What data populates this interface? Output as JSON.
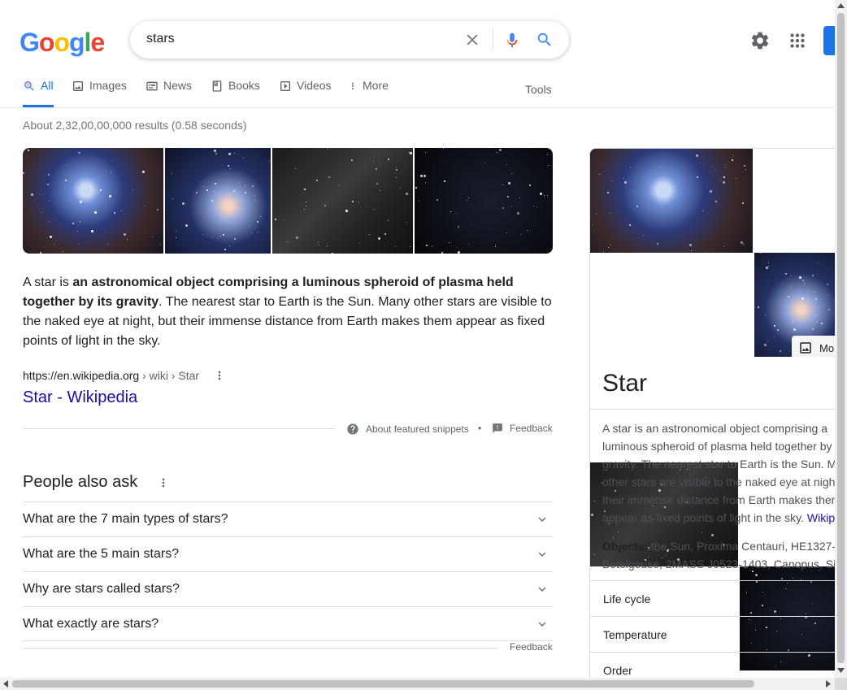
{
  "header": {
    "logo_letters": [
      {
        "ch": "G",
        "color": "#4285F4"
      },
      {
        "ch": "o",
        "color": "#EA4335"
      },
      {
        "ch": "o",
        "color": "#FBBC05"
      },
      {
        "ch": "g",
        "color": "#4285F4"
      },
      {
        "ch": "l",
        "color": "#34A853"
      },
      {
        "ch": "e",
        "color": "#EA4335"
      }
    ],
    "search_query": "stars"
  },
  "tabs": [
    {
      "label": "All",
      "icon": "search-icon",
      "active": true
    },
    {
      "label": "Images",
      "icon": "image-icon",
      "active": false
    },
    {
      "label": "News",
      "icon": "news-icon",
      "active": false
    },
    {
      "label": "Books",
      "icon": "book-icon",
      "active": false
    },
    {
      "label": "Videos",
      "icon": "video-icon",
      "active": false
    },
    {
      "label": "More",
      "icon": "more-vert-icon",
      "active": false
    }
  ],
  "tools_label": "Tools",
  "result_stats": "About 2,32,00,00,000 results (0.58 seconds)",
  "featured_snippet": {
    "prefix": "A star is ",
    "bold": "an astronomical object comprising a luminous spheroid of plasma held together by its gravity",
    "suffix": ". The nearest star to Earth is the Sun. Many other stars are visible to the naked eye at night, but their immense distance from Earth makes them appear as fixed points of light in the sky.",
    "cite_domain": "https://en.wikipedia.org",
    "cite_path": " › wiki › Star",
    "link_title": "Star - Wikipedia",
    "about_label": "About featured snippets",
    "separator": "•",
    "feedback_label": "Feedback"
  },
  "people_also_ask": {
    "title": "People also ask",
    "questions": [
      "What are the 7 main types of stars?",
      "What are the 5 main stars?",
      "Why are stars called stars?",
      "What exactly are stars?"
    ],
    "feedback_label": "Feedback"
  },
  "knowledge_panel": {
    "more_images_label": "Mo",
    "title": "Star",
    "description": "A star is an astronomical object comprising a luminous spheroid of plasma held together by its gravity. The nearest star to Earth is the Sun. Many other stars are visible to the naked eye at night, but their immense distance from Earth makes them appear as fixed points of light in the sky.",
    "desc_lines": [
      "A star is an astronomical object comprising a",
      "luminous spheroid of plasma held together by i",
      "gravity. The nearest star to Earth is the Sun. M",
      "other stars are visible to the naked eye at nigh",
      "their immense distance from Earth makes them",
      "appear as fixed points of light in the sky. "
    ],
    "source_link": "Wikip",
    "objects_label": "Objects:",
    "objects_line1": " the Sun, Proxima Centauri, HE1327-",
    "objects_line2": "Betelgeuse, 2MASS J0523-1403, Canopus, Si",
    "rows": [
      "Life cycle",
      "Temperature",
      "Order"
    ]
  }
}
